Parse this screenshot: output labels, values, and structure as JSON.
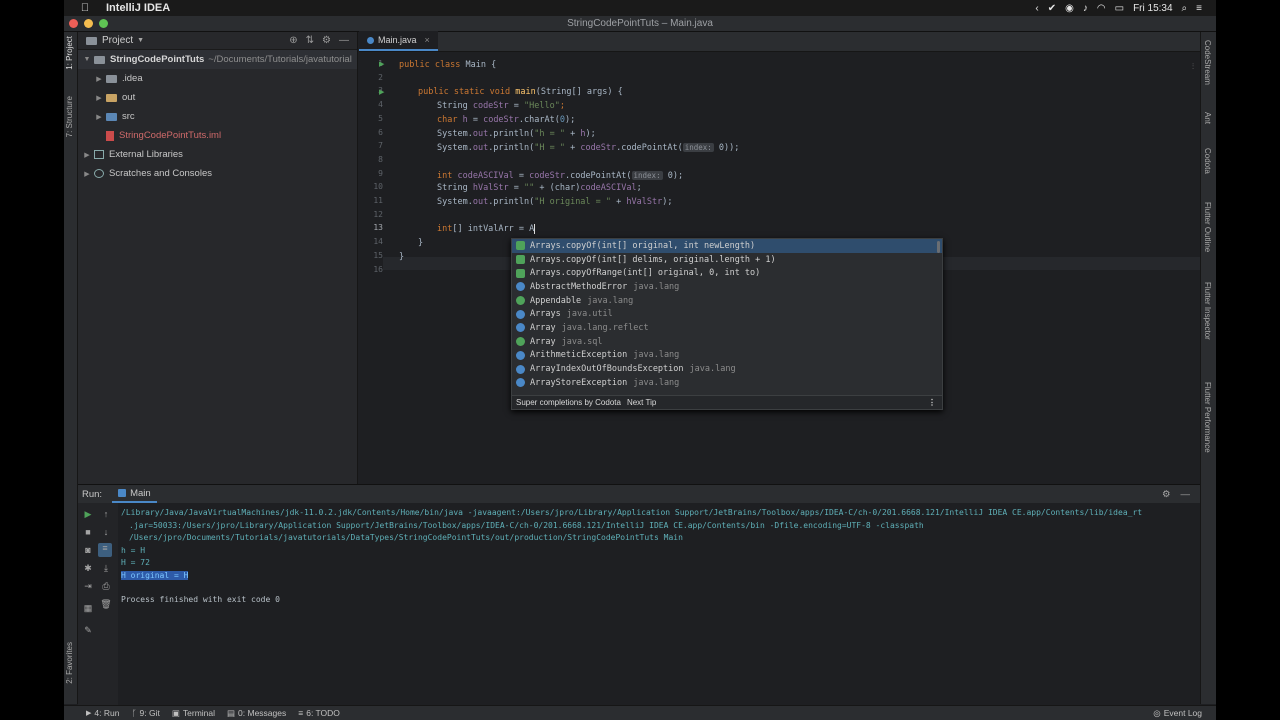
{
  "menubar": {
    "app_name": "IntelliJ IDEA",
    "clock": "Fri 15:34"
  },
  "window": {
    "title": "StringCodePointTuts – Main.java"
  },
  "left_strip": {
    "project_tab": "1: Project",
    "structure_tab": "7: Structure",
    "favorites_tab": "2: Favorites"
  },
  "right_strip": {
    "tabs": [
      "CodeStream",
      "Ant",
      "Codota",
      "Flutter Outline",
      "Flutter Inspector",
      "Flutter Performance"
    ]
  },
  "project": {
    "header": "Project",
    "root_name": "StringCodePointTuts",
    "root_path": "~/Documents/Tutorials/javatutorial",
    "items": [
      {
        "label": ".idea",
        "kind": "folder-grey"
      },
      {
        "label": "out",
        "kind": "folder"
      },
      {
        "label": "src",
        "kind": "folder"
      },
      {
        "label": "StringCodePointTuts.iml",
        "kind": "file"
      },
      {
        "label": "External Libraries",
        "kind": "library"
      },
      {
        "label": "Scratches and Consoles",
        "kind": "scratch"
      }
    ]
  },
  "editor": {
    "tab_label": "Main.java",
    "line_numbers": [
      "1",
      "2",
      "3",
      "4",
      "5",
      "6",
      "7",
      "8",
      "9",
      "10",
      "11",
      "12",
      "13",
      "14",
      "15",
      "16"
    ],
    "lines": {
      "l1_kw": "public class ",
      "l1_rest": "Main {",
      "l3_kw": "public static void ",
      "l3_m": "main",
      "l3_rest": "(String[] args) {",
      "l4_a": "String ",
      "l4_b": "codeStr",
      "l4_c": " = ",
      "l4_s": "\"Hello\"",
      "l4_e": ";",
      "l5_a": "char ",
      "l5_b": "h",
      "l5_c": " = ",
      "l5_d": "codeStr",
      "l5_e": ".charAt(",
      "l5_f": "0",
      "l5_g": ");",
      "l6_a": "System.",
      "l6_b": "out",
      "l6_c": ".println(",
      "l6_s": "\"h = \"",
      "l6_d": " + ",
      "l6_e": "h",
      "l6_f": ");",
      "l7_a": "System.",
      "l7_b": "out",
      "l7_c": ".println(",
      "l7_s": "\"H = \"",
      "l7_d": " + ",
      "l7_e": "codeStr",
      "l7_f": ".codePointAt(",
      "l7_hint": "index:",
      "l7_g": " 0));",
      "l9_a": "int ",
      "l9_b": "codeASCIVal",
      "l9_c": " = ",
      "l9_d": "codeStr",
      "l9_e": ".codePointAt(",
      "l9_hint": "index:",
      "l9_f": " 0);",
      "l10_a": "String ",
      "l10_b": "hValStr",
      "l10_c": " = ",
      "l10_s": "\"\"",
      "l10_d": " + (char)",
      "l10_e": "codeASCIVal",
      "l10_f": ";",
      "l11_a": "System.",
      "l11_b": "out",
      "l11_c": ".println(",
      "l11_s": "\"H original = \"",
      "l11_d": " + ",
      "l11_e": "hValStr",
      "l11_f": ");",
      "l13_a": "int",
      "l13_b": "[] intValArr = ",
      "l13_c": "A",
      "l14": "}",
      "l15": "}"
    }
  },
  "completion": {
    "items": [
      {
        "label": "Arrays.copyOf(int[] original, int newLength)",
        "pkg": "",
        "icon": "#4fa35a"
      },
      {
        "label": "Arrays.copyOf(int[] delims, original.length + 1)",
        "pkg": "",
        "icon": "#4fa35a"
      },
      {
        "label": "Arrays.copyOfRange(int[] original, 0, int to)",
        "pkg": "",
        "icon": "#4fa35a"
      },
      {
        "label": "AbstractMethodError",
        "pkg": "java.lang",
        "icon": "#4a88c7"
      },
      {
        "label": "Appendable",
        "pkg": "java.lang",
        "icon": "#4fa35a"
      },
      {
        "label": "Arrays",
        "pkg": "java.util",
        "icon": "#4a88c7"
      },
      {
        "label": "Array",
        "pkg": "java.lang.reflect",
        "icon": "#4a88c7"
      },
      {
        "label": "Array",
        "pkg": "java.sql",
        "icon": "#4fa35a"
      },
      {
        "label": "ArithmeticException",
        "pkg": "java.lang",
        "icon": "#4a88c7"
      },
      {
        "label": "ArrayIndexOutOfBoundsException",
        "pkg": "java.lang",
        "icon": "#4a88c7"
      },
      {
        "label": "ArrayStoreException",
        "pkg": "java.lang",
        "icon": "#4a88c7"
      }
    ],
    "footer": "Super completions by Codota",
    "next_tip": "Next Tip"
  },
  "run": {
    "label": "Run:",
    "tab": "Main",
    "console": [
      "/Library/Java/JavaVirtualMachines/jdk-11.0.2.jdk/Contents/Home/bin/java -javaagent:/Users/jpro/Library/Application Support/JetBrains/Toolbox/apps/IDEA-C/ch-0/201.6668.121/IntelliJ IDEA CE.app/Contents/lib/idea_rt",
      ".jar=50033:/Users/jpro/Library/Application Support/JetBrains/Toolbox/apps/IDEA-C/ch-0/201.6668.121/IntelliJ IDEA CE.app/Contents/bin -Dfile.encoding=UTF-8 -classpath",
      "/Users/jpro/Documents/Tutorials/javatutorials/DataTypes/StringCodePointTuts/out/production/StringCodePointTuts Main",
      "h = H",
      "H = 72",
      "H original = H",
      "Process finished with exit code 0"
    ]
  },
  "statusbar": {
    "run": "4: Run",
    "git": "9: Git",
    "terminal": "Terminal",
    "messages": "0: Messages",
    "todo": "6: TODO",
    "event_log": "Event Log"
  },
  "colors": {
    "accent": "#4a88c7",
    "keyword": "#cc7832",
    "string": "#6a8759",
    "field": "#9876aa",
    "method": "#ffc66d"
  }
}
